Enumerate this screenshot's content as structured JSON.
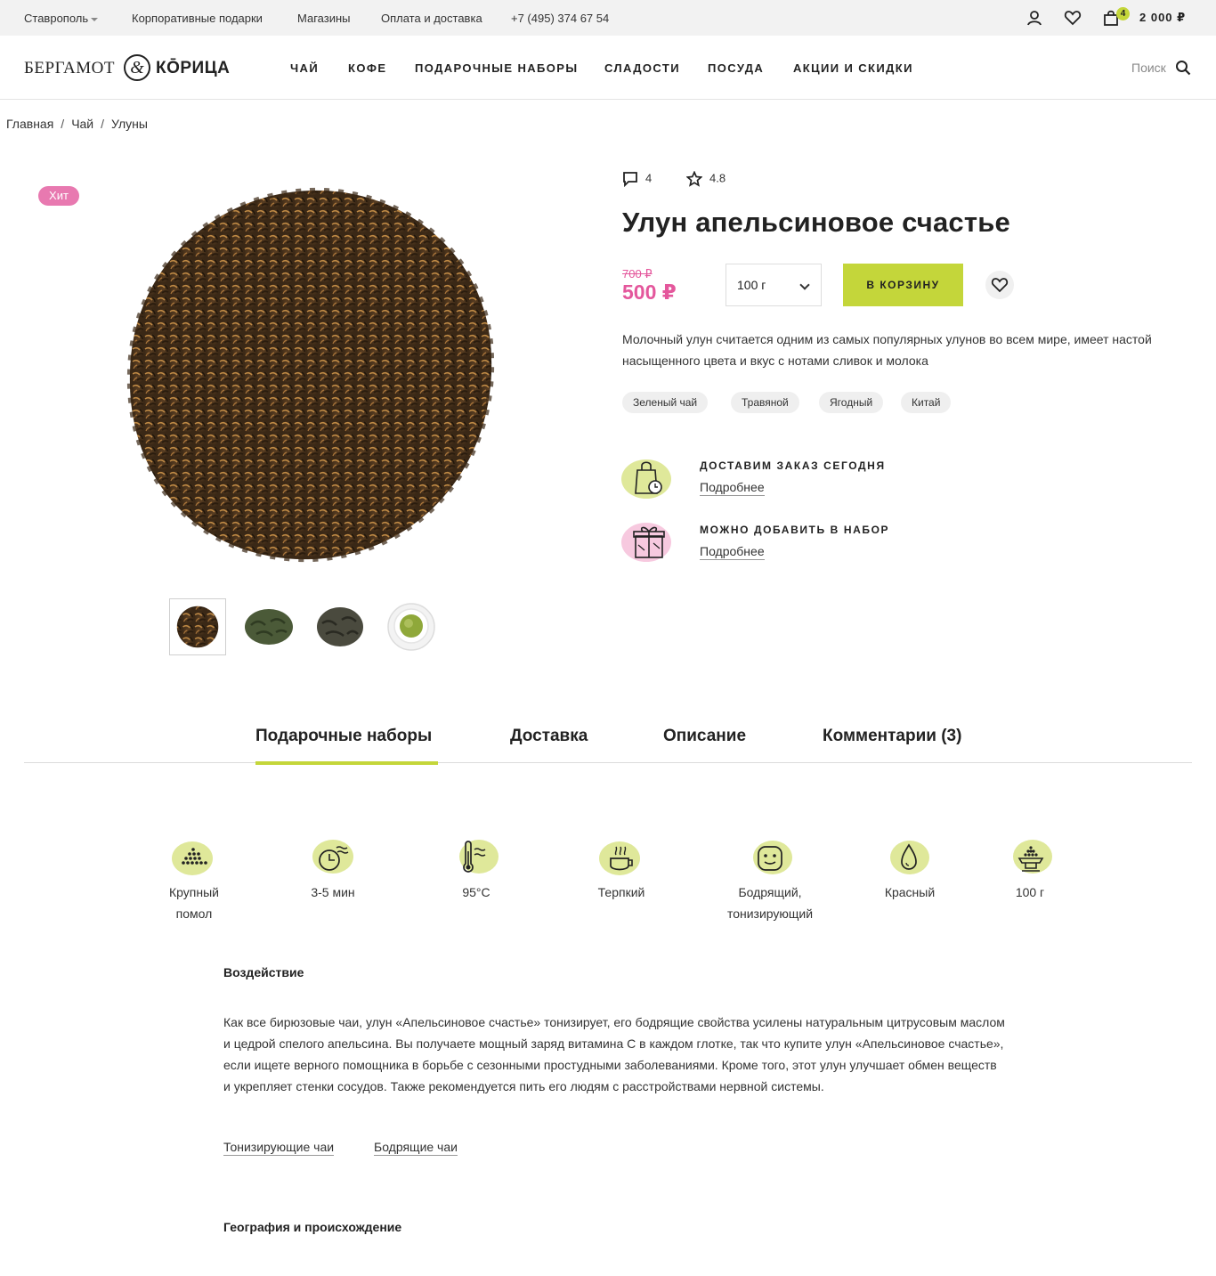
{
  "topbar": {
    "city": "Ставрополь",
    "links": [
      "Корпоративные подарки",
      "Магазины",
      "Оплата и доставка"
    ],
    "phone": "+7 (495) 374 67 54",
    "cart_count": "4",
    "cart_total": "2 000 ₽"
  },
  "header": {
    "logo_left": "БЕРГАМОТ",
    "logo_amp": "&",
    "logo_right": "КŌРИЦА",
    "nav": [
      "ЧАЙ",
      "КОФЕ",
      "ПОДАРОЧНЫЕ НАБОРЫ",
      "СЛАДОСТИ",
      "ПОСУДА",
      "АКЦИИ И СКИДКИ"
    ],
    "search_label": "Поиск"
  },
  "breadcrumb": [
    "Главная",
    "Чай",
    "Улуны"
  ],
  "product": {
    "badge": "Хит",
    "comments_count": "4",
    "rating": "4.8",
    "title": "Улун апельсиновое счастье",
    "old_price": "700 ₽",
    "price": "500 ₽",
    "weight": "100 г",
    "cart_button": "В КОРЗИНУ",
    "description": "Молочный улун считается одним из самых популярных улунов во всем мире, имеет настой насыщенного цвета и вкус с нотами сливок и молока",
    "tags": [
      "Зеленый чай",
      "Травяной",
      "Ягодный",
      "Китай"
    ]
  },
  "features": [
    {
      "title": "ДОСТАВИМ ЗАКАЗ СЕГОДНЯ",
      "link": "Подробнее",
      "icon": "shopping-bag-clock-icon"
    },
    {
      "title": "МОЖНО ДОБАВИТЬ В НАБОР",
      "link": "Подробнее",
      "icon": "gift-box-icon"
    }
  ],
  "tabs": [
    "Подарочные наборы",
    "Доставка",
    "Описание",
    "Комментарии (3)"
  ],
  "characteristics": [
    {
      "label": "Крупный\nпомол",
      "icon": "grind-icon"
    },
    {
      "label": "3-5 мин",
      "icon": "brew-time-icon"
    },
    {
      "label": "95°С",
      "icon": "thermometer-icon"
    },
    {
      "label": "Терпкий",
      "icon": "cup-steam-icon"
    },
    {
      "label": "Бодрящий,\nтонизирующий",
      "icon": "smiley-icon"
    },
    {
      "label": "Красный",
      "icon": "drop-icon"
    },
    {
      "label": "100 г",
      "icon": "scale-icon"
    }
  ],
  "effect": {
    "title": "Воздействие",
    "text": "Как все бирюзовые чаи, улун «Апельсиновое счастье» тонизирует, его бодрящие свойства усилены натуральным цитрусовым маслом и цедрой спелого апельсина. Вы получаете мощный заряд витамина С в каждом глотке, так что купите улун «Апельсиновое счастье», если ищете верного помощника в борьбе с сезонными простудными заболеваниями. Кроме того, этот улун улучшает обмен веществ и укрепляет стенки сосудов. Также рекомендуется пить его людям с расстройствами нервной системы.",
    "links": [
      "Тонизирующие чаи",
      "Бодрящие чаи"
    ]
  },
  "geography": {
    "title": "География и происхождение"
  },
  "colors": {
    "accent_green": "#c4d63a",
    "accent_pink": "#e4579c",
    "badge_pink": "#e879b0"
  }
}
